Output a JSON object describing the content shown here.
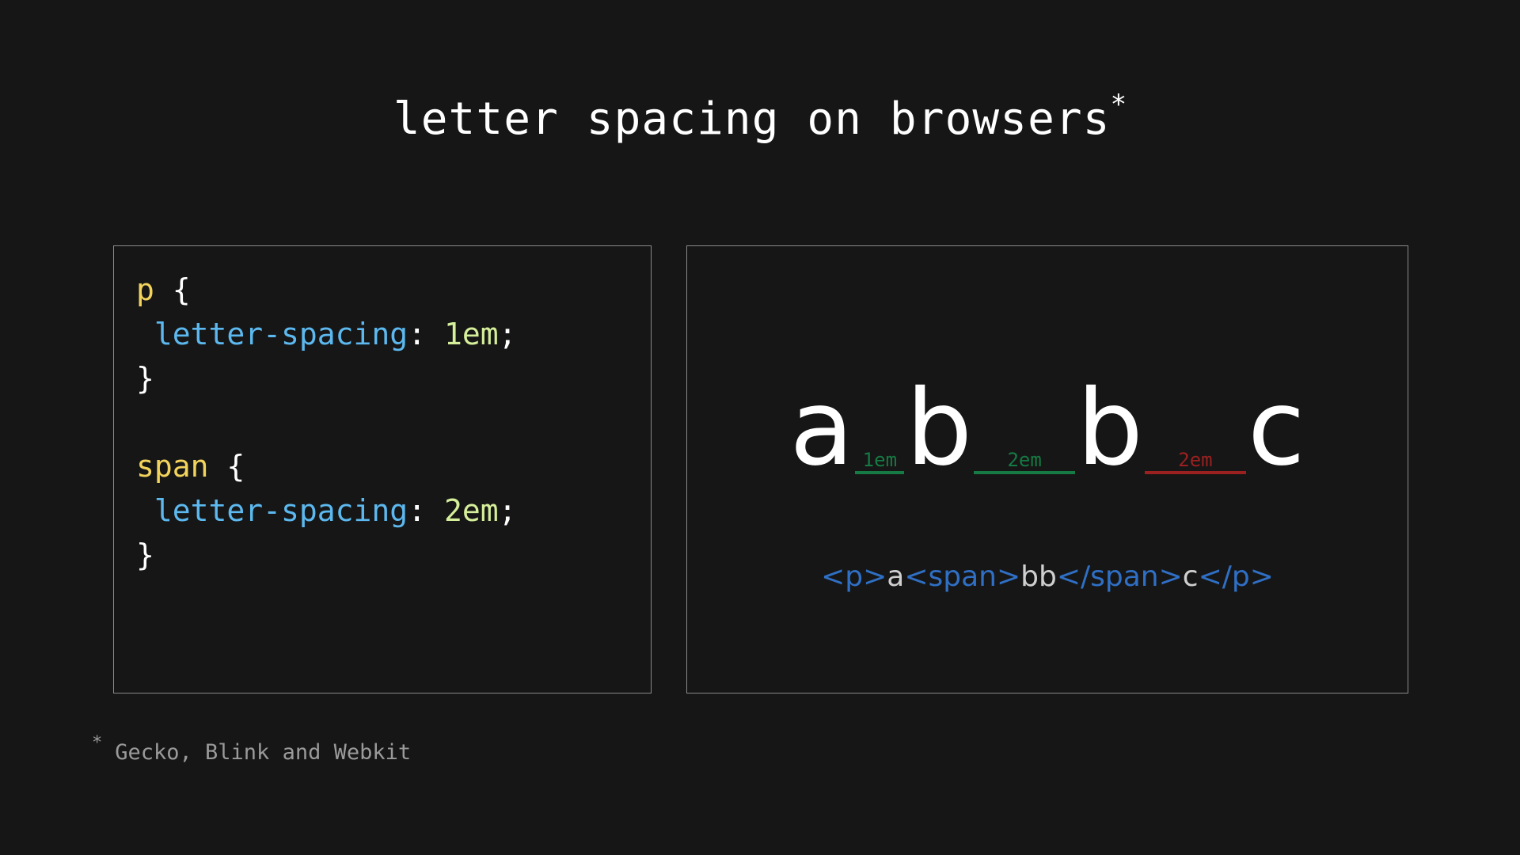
{
  "theme": {
    "background": "#161616",
    "text": "#e8e8e8",
    "panel_border": "#8a8a8a",
    "accent_selector": "#f2d35c",
    "accent_property": "#5cb8ee",
    "accent_value": "#d5ef9a",
    "accent_tag": "#2f6fc4",
    "ok_green": "#157a43",
    "bad_red": "#9b2020",
    "muted": "#9a9a9a"
  },
  "title": {
    "text": "letter spacing on browsers",
    "footnote_marker": "*"
  },
  "code_panel": {
    "language": "css",
    "lines": [
      {
        "selector": "p",
        "open": " {"
      },
      {
        "indent": " ",
        "property": "letter-spacing",
        "colon": ": ",
        "value": "1em",
        "semi": ";"
      },
      {
        "close": "}"
      },
      {
        "blank": ""
      },
      {
        "selector": "span",
        "open": " {"
      },
      {
        "indent": " ",
        "property": "letter-spacing",
        "colon": ": ",
        "value": "2em",
        "semi": ";"
      },
      {
        "close": "}"
      }
    ],
    "raw": "p {\n  letter-spacing: 1em;\n}\n\nspan {\n  letter-spacing: 2em;\n}"
  },
  "demo_panel": {
    "letters": [
      "a",
      "b",
      "b",
      "c"
    ],
    "gaps": [
      {
        "label": "1em",
        "status": "ok",
        "color": "#157a43",
        "width_em": 1
      },
      {
        "label": "2em",
        "status": "ok",
        "color": "#157a43",
        "width_em": 2
      },
      {
        "label": "2em",
        "status": "bad",
        "color": "#9b2020",
        "width_em": 2
      }
    ],
    "markup": {
      "full": "<p>a<span>bb</span>c</p>",
      "parts": [
        {
          "kind": "tag",
          "text": "<p>"
        },
        {
          "kind": "text",
          "text": "a"
        },
        {
          "kind": "tag",
          "text": "<span>"
        },
        {
          "kind": "text",
          "text": "bb"
        },
        {
          "kind": "tag",
          "text": "</span>"
        },
        {
          "kind": "text",
          "text": "c"
        },
        {
          "kind": "tag",
          "text": "</p>"
        }
      ]
    }
  },
  "footnote": {
    "marker": "*",
    "text": "Gecko, Blink and Webkit"
  }
}
